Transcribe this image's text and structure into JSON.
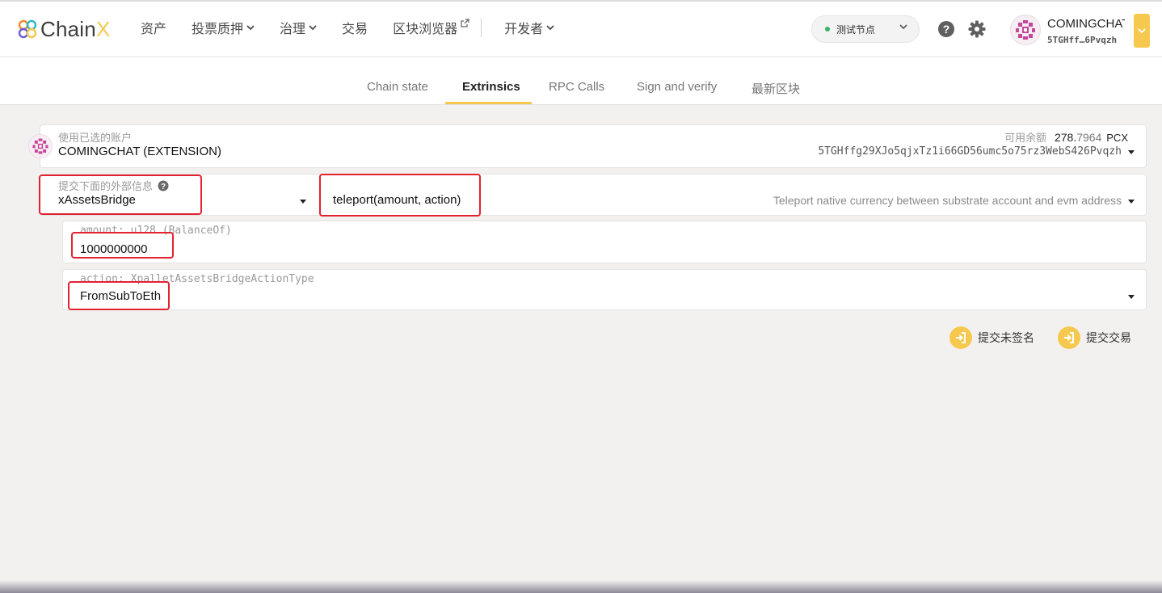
{
  "brand": {
    "name_prefix": "Chain",
    "name_suffix": "X"
  },
  "nav": {
    "items": [
      {
        "label": "资产"
      },
      {
        "label": "投票质押"
      },
      {
        "label": "治理"
      },
      {
        "label": "交易"
      },
      {
        "label": "区块浏览器"
      },
      {
        "label": "开发者"
      }
    ]
  },
  "node": {
    "label": "测试节点"
  },
  "account": {
    "name": "COMINGCHAT",
    "address_short": "5TGHff…6Pvqzh"
  },
  "tabs": [
    {
      "label": "Chain state"
    },
    {
      "label": "Extrinsics"
    },
    {
      "label": "RPC Calls"
    },
    {
      "label": "Sign and verify"
    },
    {
      "label": "最新区块"
    }
  ],
  "sender": {
    "label": "使用已选的账户",
    "name": "COMINGCHAT (EXTENSION)",
    "balance_label": "可用余额",
    "balance_int": "278.",
    "balance_dec": "7964",
    "balance_unit": "PCX",
    "address": "5TGHffg29XJo5qjxTz1i66GD56umc5o75rz3WebS426Pvqzh"
  },
  "extrinsic": {
    "label": "提交下面的外部信息",
    "module": "xAssetsBridge",
    "method": "teleport(amount, action)",
    "description": "Teleport native currency between substrate account and evm address"
  },
  "params": {
    "amount_label": "amount: u128 (BalanceOf)",
    "amount_value": "1000000000",
    "action_label": "action: XpalletAssetsBridgeActionType",
    "action_value": "FromSubToEth"
  },
  "buttons": {
    "submit_unsigned": "提交未签名",
    "submit": "提交交易"
  },
  "colors": {
    "accent": "#f6c94e",
    "highlight": "#e3222f",
    "status_green": "#39b36b"
  }
}
